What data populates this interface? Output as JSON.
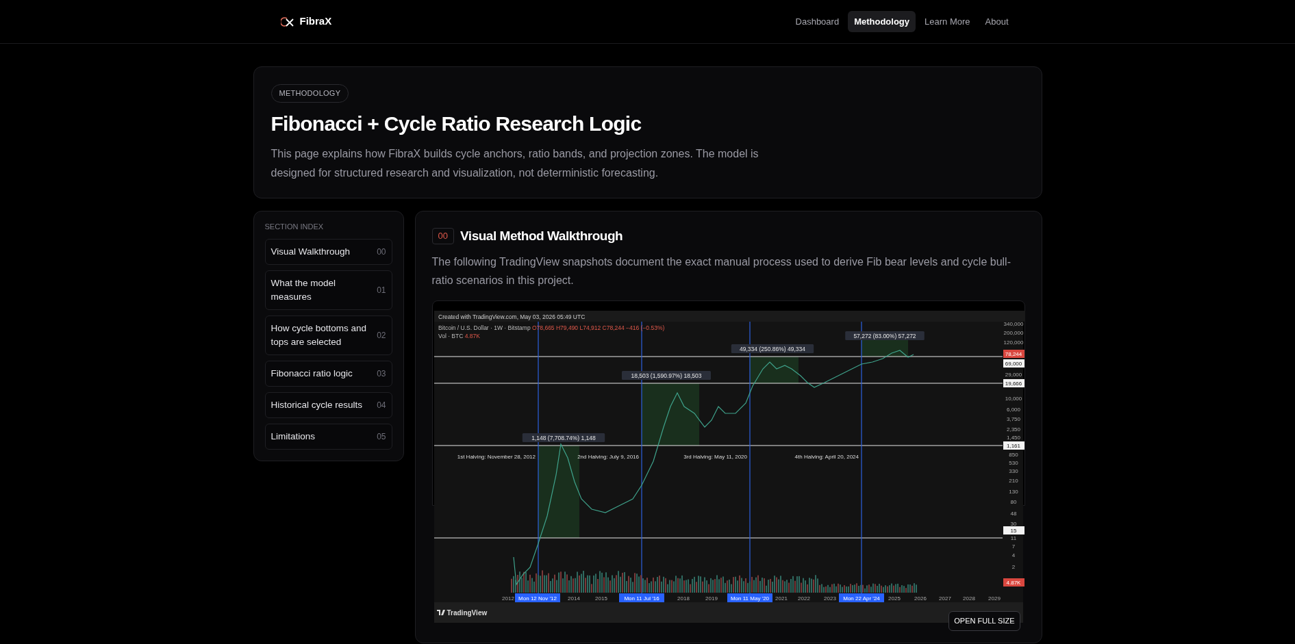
{
  "nav": {
    "logo": "FibraX",
    "links": [
      {
        "label": "Dashboard",
        "selected": false
      },
      {
        "label": "Methodology",
        "selected": true
      },
      {
        "label": "Learn More",
        "selected": false
      },
      {
        "label": "About",
        "selected": false
      }
    ]
  },
  "hero": {
    "badge": "METHODOLOGY",
    "title": "Fibonacci + Cycle Ratio Research Logic",
    "description": "This page explains how FibraX builds cycle anchors, ratio bands, and projection zones. The model is designed for structured research and visualization, not deterministic forecasting."
  },
  "sidebar": {
    "heading": "SECTION INDEX",
    "items": [
      {
        "label": "Visual Walkthrough",
        "number": "00"
      },
      {
        "label": "What the model measures",
        "number": "01"
      },
      {
        "label": "How cycle bottoms and tops are selected",
        "number": "02"
      },
      {
        "label": "Fibonacci ratio logic",
        "number": "03"
      },
      {
        "label": "Historical cycle results",
        "number": "04"
      },
      {
        "label": "Limitations",
        "number": "05"
      }
    ]
  },
  "section": {
    "number": "00",
    "title": "Visual Method Walkthrough",
    "description": "The following TradingView snapshots document the exact manual process used to derive Fib bear levels and cycle bull-ratio scenarios in this project.",
    "snapshot": {
      "header": "Created with TradingView.com, May 03, 2026 05:49 UTC",
      "symbol": "Bitcoin / U.S. Dollar · 1W · Bitstamp",
      "ohlc": "O78,665 H79,490 L74,912 C78,244 −416 (−0.53%)",
      "volume_label": "Vol · BTC",
      "volume_value": "4.87K",
      "range_labels": [
        "1,148 (7,708.74%) 1,148",
        "18,503 (1,590.97%) 18,503",
        "49,334 (250.86%) 49,334",
        "57,272 (83.00%) 57,272"
      ],
      "halvings": [
        "1st Halving: November 28, 2012",
        "2nd Halving: July 9, 2016",
        "3rd Halving: May 11, 2020",
        "4th Halving: April 20, 2024"
      ],
      "price_axis": [
        {
          "text": "340,000",
          "kind": "plain"
        },
        {
          "text": "200,000",
          "kind": "plain"
        },
        {
          "text": "120,000",
          "kind": "plain"
        },
        {
          "text": "78,244",
          "kind": "current"
        },
        {
          "text": "69,000",
          "kind": "marker"
        },
        {
          "text": "29,000",
          "kind": "plain"
        },
        {
          "text": "19,666",
          "kind": "marker"
        },
        {
          "text": "10,000",
          "kind": "plain"
        },
        {
          "text": "6,000",
          "kind": "plain"
        },
        {
          "text": "3,750",
          "kind": "plain"
        },
        {
          "text": "2,350",
          "kind": "plain"
        },
        {
          "text": "1,450",
          "kind": "plain"
        },
        {
          "text": "1,161",
          "kind": "marker"
        },
        {
          "text": "850",
          "kind": "plain"
        },
        {
          "text": "530",
          "kind": "plain"
        },
        {
          "text": "330",
          "kind": "plain"
        },
        {
          "text": "210",
          "kind": "plain"
        },
        {
          "text": "130",
          "kind": "plain"
        },
        {
          "text": "80",
          "kind": "plain"
        },
        {
          "text": "48",
          "kind": "plain"
        },
        {
          "text": "30",
          "kind": "plain"
        },
        {
          "text": "15",
          "kind": "marker"
        },
        {
          "text": "11",
          "kind": "plain"
        },
        {
          "text": "7",
          "kind": "plain"
        },
        {
          "text": "4",
          "kind": "plain"
        },
        {
          "text": "2",
          "kind": "plain"
        },
        {
          "text": "4.87K",
          "kind": "current"
        }
      ],
      "years": [
        "2012",
        "2014",
        "2015",
        "2018",
        "2019",
        "2021",
        "2022",
        "2023",
        "2025",
        "2026",
        "2027",
        "2028",
        "2029"
      ],
      "date_markers": [
        "Mon 12 Nov '12",
        "Mon 11 Jul '16",
        "Mon 11 May '20",
        "Mon 22 Apr '24"
      ],
      "brand": "TradingView"
    },
    "button": "OPEN FULL SIZE"
  }
}
